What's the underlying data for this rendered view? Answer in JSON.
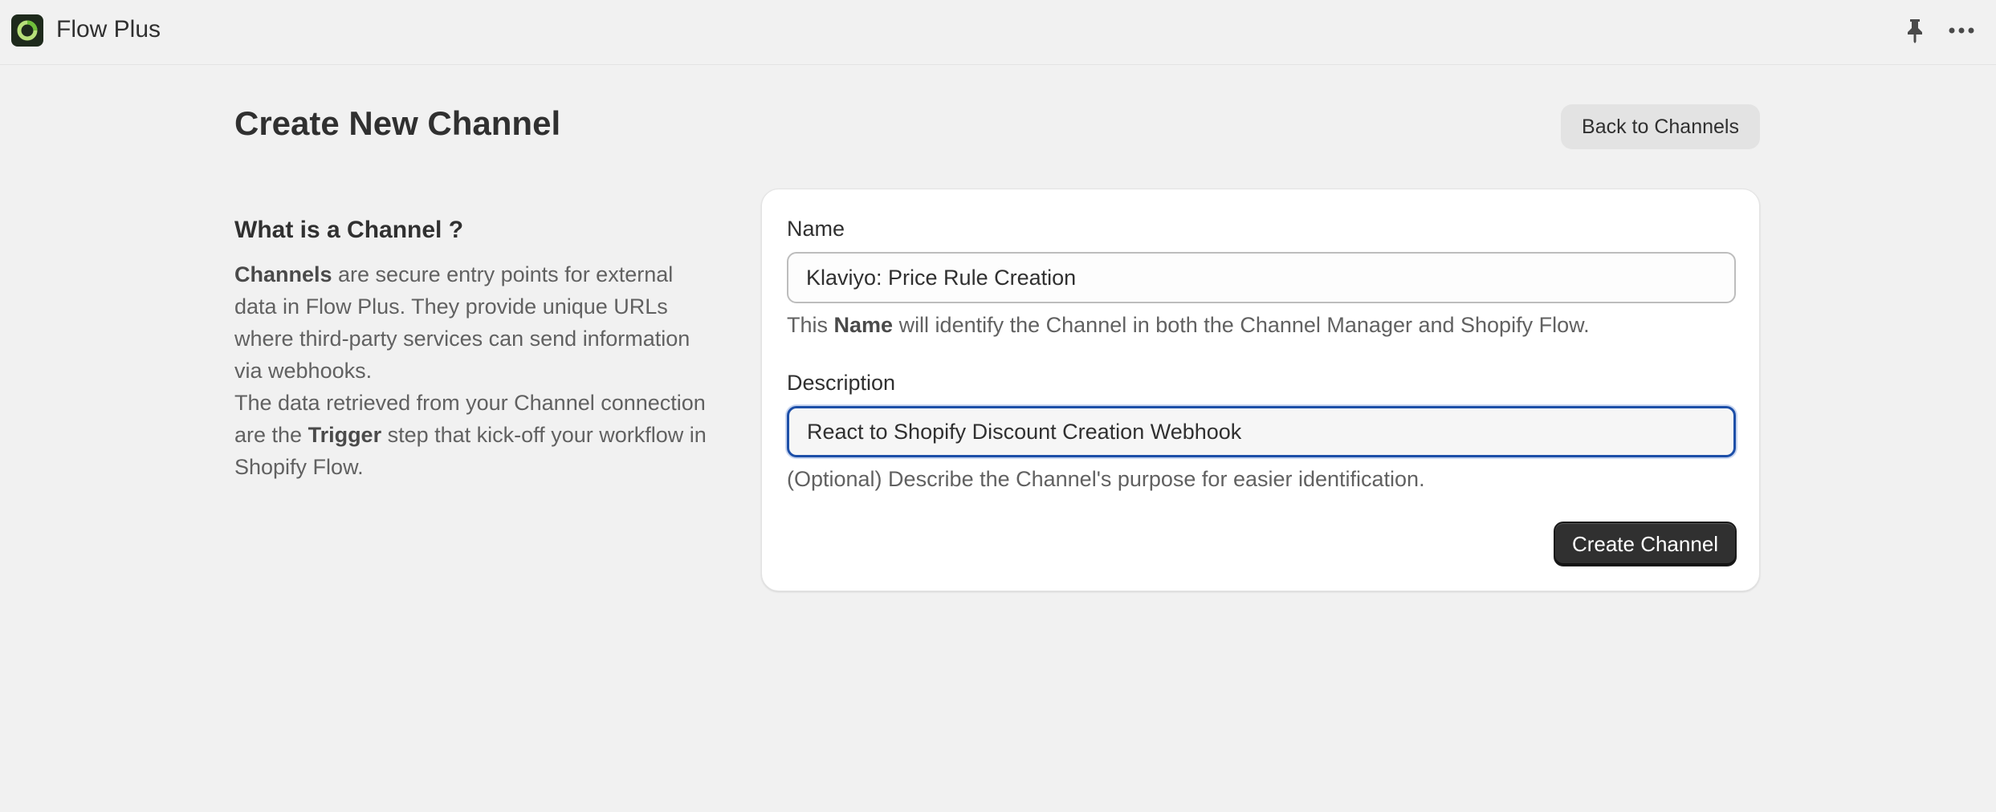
{
  "app": {
    "title": "Flow Plus",
    "logo_icon": "flow-plus-logo",
    "pin_icon": "pin-icon",
    "more_icon": "more-horizontal-icon"
  },
  "header": {
    "title": "Create New Channel",
    "back_label": "Back to Channels"
  },
  "info": {
    "heading": "What is a Channel ?",
    "p1_bold": "Channels",
    "p1_rest": " are secure entry points for external data in Flow Plus. They provide unique URLs where third-party services can send information via webhooks.",
    "p2_start": "The data retrieved from your Channel connection are the ",
    "p2_bold": "Trigger",
    "p2_end": " step that kick-off your workflow in Shopify Flow."
  },
  "form": {
    "name_label": "Name",
    "name_value": "Klaviyo: Price Rule Creation",
    "name_help_start": "This ",
    "name_help_bold": "Name",
    "name_help_end": " will identify the Channel in both the Channel Manager and Shopify Flow.",
    "description_label": "Description",
    "description_value": "React to Shopify Discount Creation Webhook",
    "description_help": "(Optional) Describe the Channel's purpose for easier identification.",
    "submit_label": "Create Channel"
  },
  "colors": {
    "background": "#f1f1f1",
    "card": "#ffffff",
    "primary_button": "#303030",
    "focus_ring": "#1d4fa8"
  }
}
